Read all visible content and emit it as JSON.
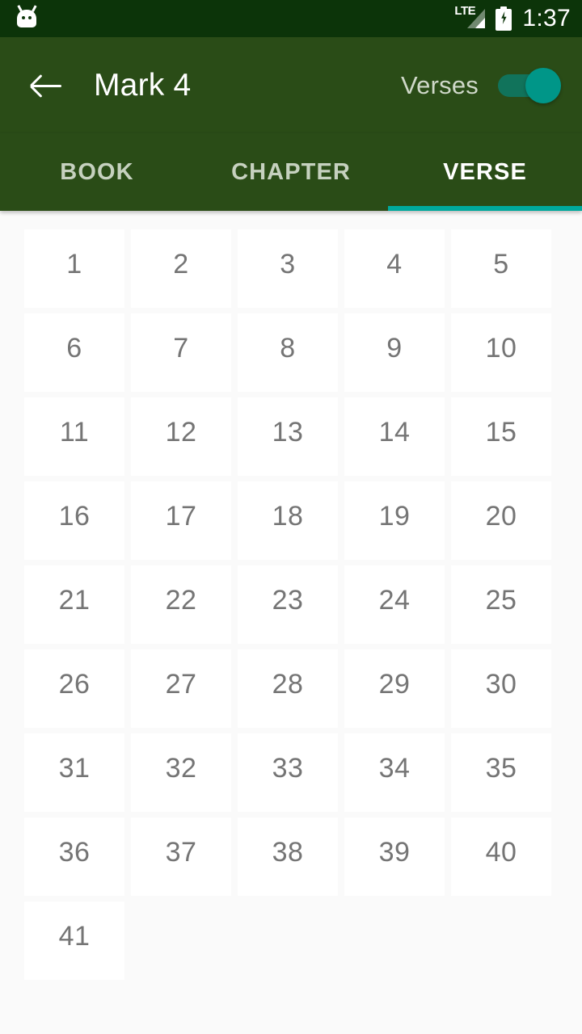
{
  "status_bar": {
    "app_icon": "android-logo-icon",
    "network_type": "LTE",
    "signal_icon": "signal-bars-icon",
    "battery_icon": "battery-charging-icon",
    "time": "1:37",
    "background_color": "#0C3409"
  },
  "app_bar": {
    "back_icon": "back-arrow-icon",
    "title": "Mark 4",
    "toggle_label": "Verses",
    "toggle_state": "on",
    "background_color": "#2A4C17",
    "accent_color": "#009688"
  },
  "tabs": {
    "items": [
      {
        "label": "BOOK",
        "active": false
      },
      {
        "label": "CHAPTER",
        "active": false
      },
      {
        "label": "VERSE",
        "active": true
      }
    ],
    "indicator_color": "#00A99D",
    "active_text_color": "#FFFFFF",
    "inactive_text_color": "#C6D1BF"
  },
  "verse_grid": {
    "columns": 5,
    "cell_background": "#FFFFFF",
    "page_background": "#FAFAFA",
    "number_color": "#757575",
    "verses": [
      "1",
      "2",
      "3",
      "4",
      "5",
      "6",
      "7",
      "8",
      "9",
      "10",
      "11",
      "12",
      "13",
      "14",
      "15",
      "16",
      "17",
      "18",
      "19",
      "20",
      "21",
      "22",
      "23",
      "24",
      "25",
      "26",
      "27",
      "28",
      "29",
      "30",
      "31",
      "32",
      "33",
      "34",
      "35",
      "36",
      "37",
      "38",
      "39",
      "40",
      "41"
    ]
  }
}
